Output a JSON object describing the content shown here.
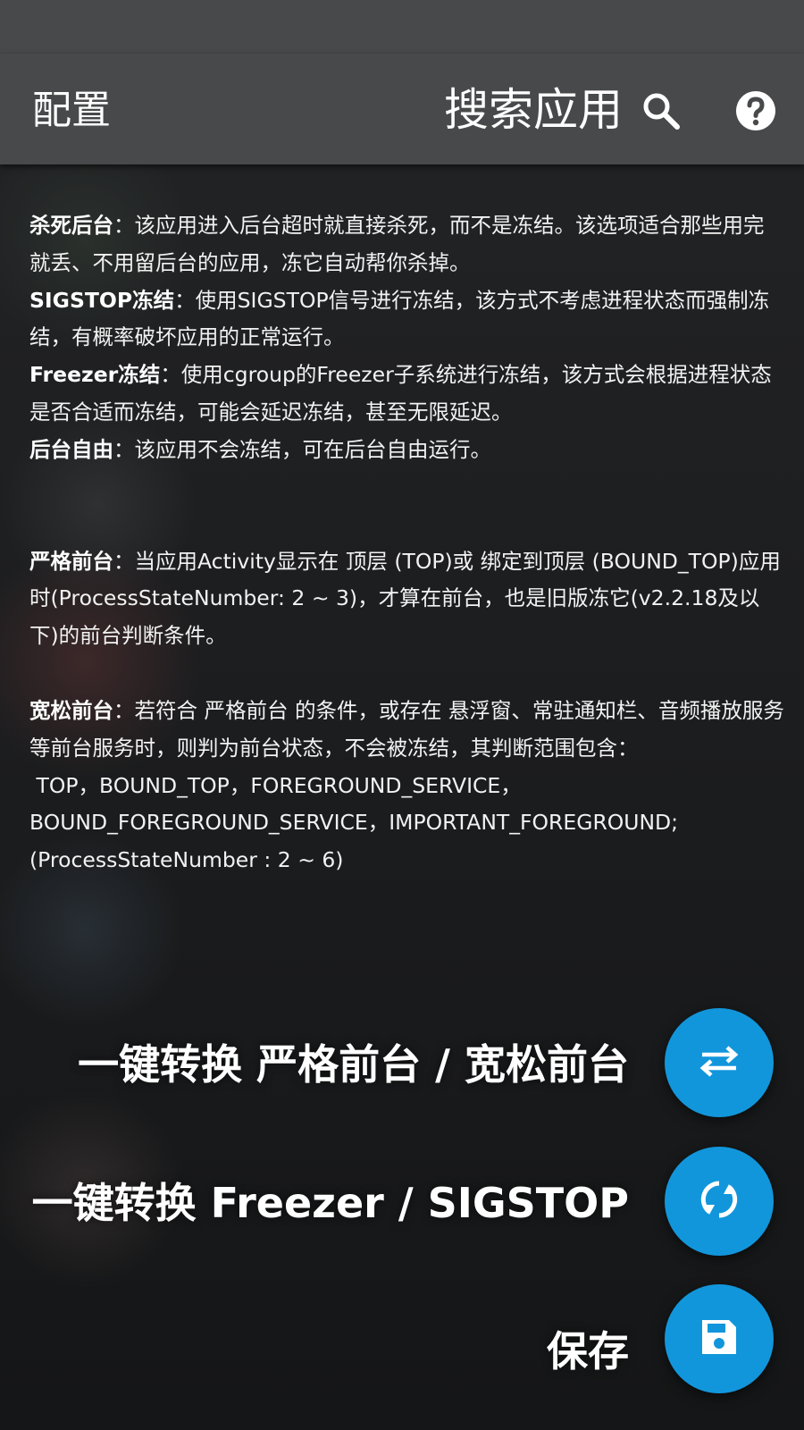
{
  "toolbar": {
    "title": "配置",
    "search_label": "搜索应用",
    "search_icon": "search-icon",
    "help_icon": "help-icon"
  },
  "descriptions": {
    "kill": {
      "term": "杀死后台",
      "text": "：该应用进入后台超时就直接杀死，而不是冻结。该选项适合那些用完就丢、不用留后台的应用，冻它自动帮你杀掉。"
    },
    "sigstop": {
      "term": "SIGSTOP冻结",
      "text": "：使用SIGSTOP信号进行冻结，该方式不考虑进程状态而强制冻结，有概率破坏应用的正常运行。"
    },
    "freezer": {
      "term": "Freezer冻结",
      "text": "：使用cgroup的Freezer子系统进行冻结，该方式会根据进程状态是否合适而冻结，可能会延迟冻结，甚至无限延迟。"
    },
    "free": {
      "term": "后台自由",
      "text": "：该应用不会冻结，可在后台自由运行。"
    },
    "strict": {
      "term": "严格前台",
      "text": "：当应用Activity显示在 顶层 (TOP)或 绑定到顶层 (BOUND_TOP)应用时(ProcessStateNumber: 2 ~ 3)，才算在前台，也是旧版冻它(v2.2.18及以下)的前台判断条件。"
    },
    "loose": {
      "term": "宽松前台",
      "text": "：若符合 严格前台 的条件，或存在 悬浮窗、常驻通知栏、音频播放服务 等前台服务时，则判为前台状态，不会被冻结，其判断范围包含：",
      "line2": " TOP，BOUND_TOP，FOREGROUND_SERVICE，",
      "line3": "BOUND_FOREGROUND_SERVICE，IMPORTANT_FOREGROUND;",
      "line4": "(ProcessStateNumber : 2 ~ 6)"
    }
  },
  "actions": [
    {
      "label": "一键转换 严格前台 / 宽松前台",
      "icon": "swap-arrows-icon"
    },
    {
      "label": "一键转换 Freezer / SIGSTOP",
      "icon": "sync-icon"
    },
    {
      "label": "保存",
      "icon": "save-icon"
    }
  ],
  "colors": {
    "toolbar": "#48494a",
    "fab": "#1296db",
    "background": "#1e1f21"
  }
}
